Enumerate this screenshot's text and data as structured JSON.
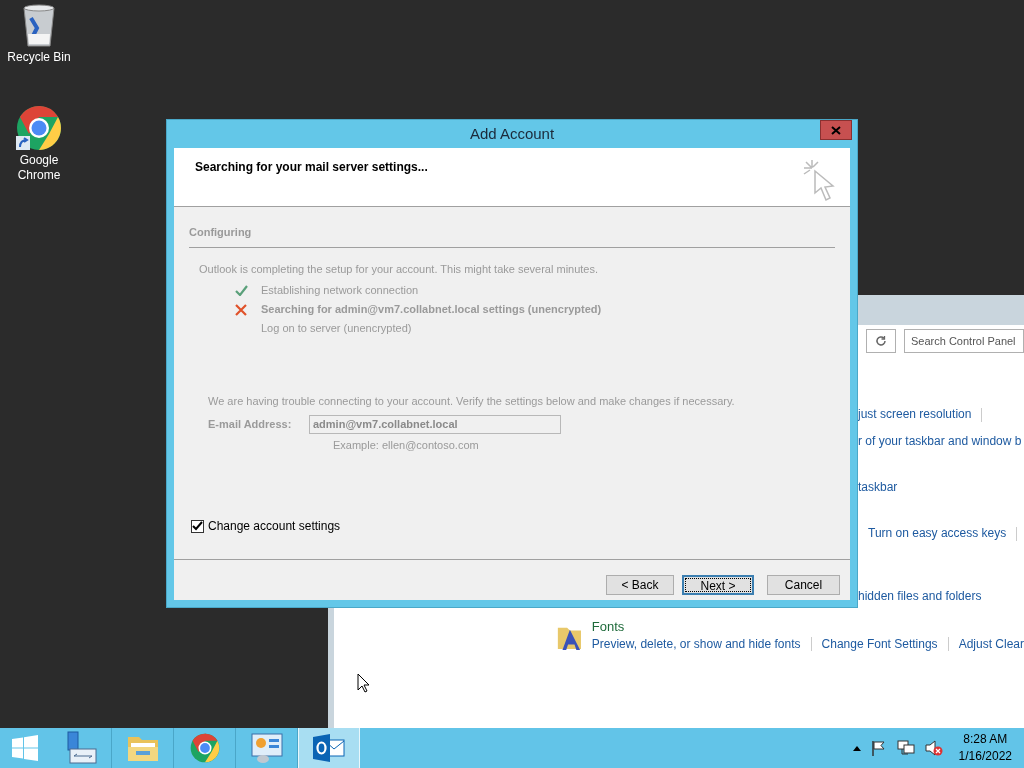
{
  "desktop_icons": [
    {
      "kind": "recycle",
      "label": "Recycle Bin"
    },
    {
      "kind": "chrome",
      "label": "Google Chrome"
    }
  ],
  "background_window": {
    "search": {
      "placeholder": "Search Control Panel"
    },
    "links": [
      {
        "label": "just screen resolution",
        "divider": true
      },
      {
        "label": "r of your taskbar and window b",
        "divider": false
      },
      {
        "label": "taskbar",
        "divider": false
      },
      {
        "label": "Turn on easy access keys",
        "divider": true
      },
      {
        "label": "hidden files and folders",
        "divider": false
      }
    ],
    "section_title": "Fonts",
    "section_links": [
      "Preview, delete, or show and hide fonts",
      "Change Font Settings",
      "Adjust Clear"
    ]
  },
  "dialog": {
    "title": "Add Account",
    "heading": "Searching for your mail server settings...",
    "section": "Configuring",
    "intro": "Outlook is completing the setup for your account. This might take several minutes.",
    "steps": [
      {
        "label": "Establishing network connection",
        "kind": "done"
      },
      {
        "label": "Searching for admin@vm7.collabnet.local settings (unencrypted)",
        "kind": "failed"
      },
      {
        "label": "Log on to server (unencrypted)",
        "kind": "pending"
      }
    ],
    "message": "We are having trouble connecting to your account. Verify the settings below and make changes if necessary.",
    "email_label": "E-mail Address:",
    "email_value": "admin@vm7.collabnet.local",
    "example": "Example: ellen@contoso.com",
    "checkbox": {
      "label": "Change account settings",
      "checked": true
    },
    "buttons": [
      {
        "label": "< Back",
        "default": false
      },
      {
        "label": "Next >",
        "default": true
      },
      {
        "label": "Cancel",
        "default": false
      }
    ]
  },
  "taskbar": {
    "apps": [
      {
        "kind": "server",
        "active": false
      },
      {
        "kind": "explorer",
        "active": false
      },
      {
        "kind": "chrome",
        "active": false
      },
      {
        "kind": "control",
        "active": false
      },
      {
        "kind": "outlook",
        "active": true
      }
    ],
    "time": "8:28 AM",
    "date": "1/16/2022"
  }
}
